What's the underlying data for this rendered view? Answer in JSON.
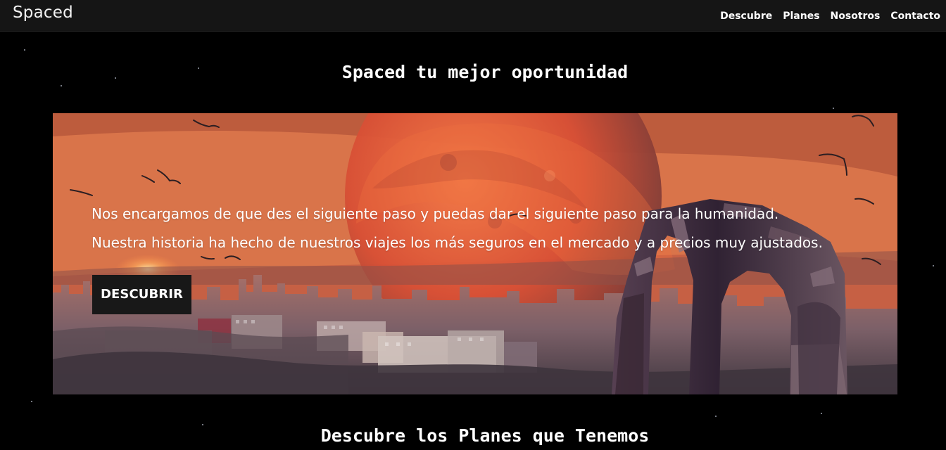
{
  "nav": {
    "brand": "Spaced",
    "links": [
      "Descubre",
      "Planes",
      "Nosotros",
      "Contacto"
    ]
  },
  "main": {
    "title": "Spaced tu mejor oportunidad",
    "hero": {
      "text": "Nos encargamos de que des el siguiente paso y puedas dar el siguiente paso para la humanidad. Nuestra historia ha hecho de nuestros viajes los más seguros en el mercado y a precios muy ajustados.",
      "button_label": "DESCUBRIR"
    },
    "section_title": "Descubre los Planes que Tenemos"
  },
  "colors": {
    "page_background": "#000000",
    "navbar_background": "#151515",
    "button_background": "#181818",
    "text": "#ffffff",
    "hero_sky": "#dc7249",
    "planet": "#d84f35",
    "city": "#7c6068",
    "tower": "#302233"
  },
  "icons": {
    "hero_image": "sunset-city-with-red-planet-and-ruined-arch"
  }
}
